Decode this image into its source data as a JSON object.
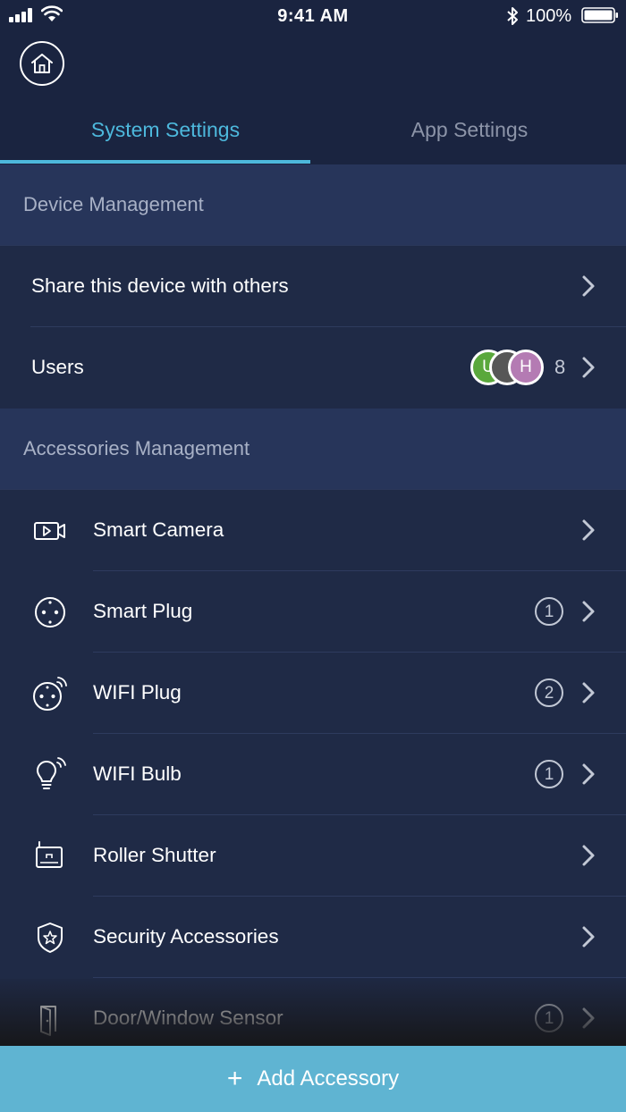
{
  "status_bar": {
    "time": "9:41 AM",
    "battery": "100%"
  },
  "tabs": [
    {
      "label": "System Settings",
      "active": true
    },
    {
      "label": "App Settings",
      "active": false
    }
  ],
  "device_management": {
    "header": "Device Management",
    "share": {
      "label": "Share this device with others"
    },
    "users": {
      "label": "Users",
      "count": "8",
      "avatars": [
        {
          "initial": "U",
          "color": "#5aa83c"
        },
        {
          "initial": "",
          "color": "#575757"
        },
        {
          "initial": "H",
          "color": "#b47bb3"
        }
      ]
    }
  },
  "accessories_management": {
    "header": "Accessories Management",
    "items": [
      {
        "label": "Smart Camera",
        "icon": "camera-icon",
        "count": ""
      },
      {
        "label": "Smart Plug",
        "icon": "plug-icon",
        "count": "1"
      },
      {
        "label": "WIFI Plug",
        "icon": "wifi-plug-icon",
        "count": "2"
      },
      {
        "label": "WIFI Bulb",
        "icon": "bulb-icon",
        "count": "1"
      },
      {
        "label": "Roller Shutter",
        "icon": "shutter-icon",
        "count": ""
      },
      {
        "label": "Security Accessories",
        "icon": "shield-icon",
        "count": ""
      },
      {
        "label": "Door/Window Sensor",
        "icon": "door-icon",
        "count": "1"
      }
    ]
  },
  "add_button": {
    "label": "Add Accessory"
  },
  "colors": {
    "accent": "#4db8dc",
    "add_button": "#5fb4d2",
    "background": "#1f2a46",
    "header_bg": "#27355a"
  }
}
